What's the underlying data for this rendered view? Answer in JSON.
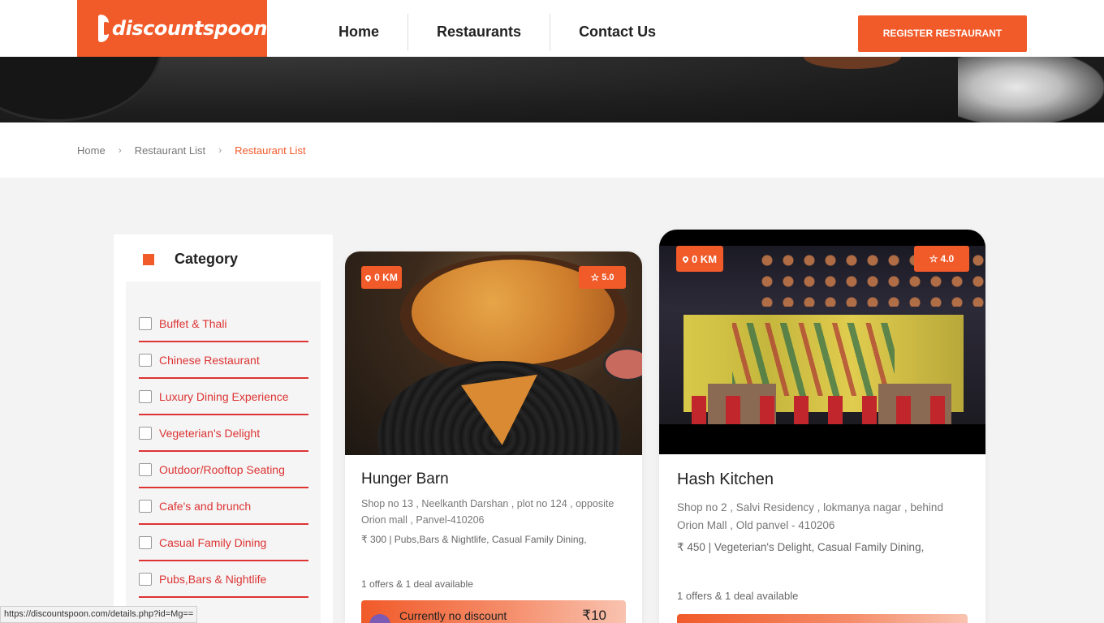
{
  "header": {
    "logo_text": "discountspoon",
    "nav": [
      {
        "label": "Home"
      },
      {
        "label": "Restaurants"
      },
      {
        "label": "Contact Us"
      }
    ],
    "register_label": "REGISTER RESTAURANT"
  },
  "breadcrumb": {
    "items": [
      "Home",
      "Restaurant List",
      "Restaurant List"
    ],
    "separator": "›"
  },
  "sidebar": {
    "title": "Category",
    "categories": [
      {
        "label": "Buffet & Thali",
        "checked": false
      },
      {
        "label": "Chinese Restaurant",
        "checked": false
      },
      {
        "label": "Luxury Dining Experience",
        "checked": false
      },
      {
        "label": "Vegeterian's Delight",
        "checked": false
      },
      {
        "label": "Outdoor/Rooftop Seating",
        "checked": false
      },
      {
        "label": "Cafe's and brunch",
        "checked": false
      },
      {
        "label": "Casual Family Dining",
        "checked": false
      },
      {
        "label": "Pubs,Bars & Nightlife",
        "checked": false
      }
    ]
  },
  "restaurants": [
    {
      "distance": "0 KM",
      "rating": "5.0",
      "name": "Hunger Barn",
      "address": "Shop no 13 , Neelkanth Darshan , plot no 124 , opposite Orion mall , Panvel-410206",
      "price_line": "₹ 300 | Pubs,Bars & Nightlife, Casual Family Dining,",
      "offers": "1 offers & 1 deal available",
      "discount_text": "Currently no discount",
      "discount_amount": "₹10"
    },
    {
      "distance": "0 KM",
      "rating": "4.0",
      "name": "Hash Kitchen",
      "address": "Shop no 2 , Salvi Residency , lokmanya nagar , behind Orion Mall , Old panvel - 410206",
      "price_line": "₹ 450 | Vegeterian's Delight, Casual Family Dining,",
      "offers": "1 offers & 1 deal available"
    }
  ],
  "status_bar": {
    "url": "https://discountspoon.com/details.php?id=Mg=="
  },
  "colors": {
    "accent": "#f15a29",
    "category_text": "#dd3333"
  },
  "icons": {
    "km_badge": "map-pin-icon",
    "rating_badge": "star-outline-icon",
    "category_marker": "square-icon",
    "checkbox": "checkbox-icon"
  }
}
